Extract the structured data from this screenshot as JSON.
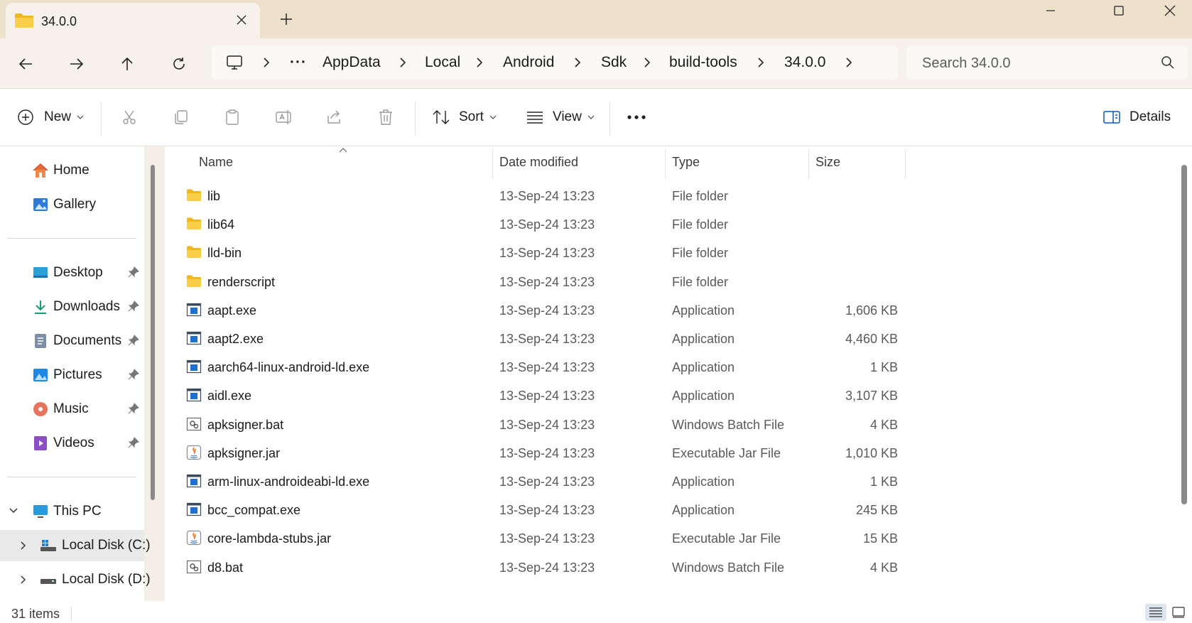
{
  "window": {
    "tab_title": "34.0.0",
    "tab_icon": "folder-icon",
    "new_tab_icon": "plus-icon",
    "controls": [
      "minimize-icon",
      "maximize-icon",
      "close-icon"
    ]
  },
  "nav_buttons": [
    "back-arrow-icon",
    "forward-arrow-icon",
    "up-arrow-icon",
    "refresh-icon"
  ],
  "breadcrumb": {
    "root_icon": "monitor-icon",
    "overflow": "···",
    "items": [
      "AppData",
      "Local",
      "Android",
      "Sdk",
      "build-tools",
      "34.0.0"
    ]
  },
  "search": {
    "placeholder": "Search 34.0.0"
  },
  "command_bar": {
    "new_label": "New",
    "sort_label": "Sort",
    "view_label": "View",
    "more_label": "···",
    "details_label": "Details",
    "disabled_actions": [
      "cut-icon",
      "copy-icon",
      "paste-icon",
      "rename-icon",
      "share-icon",
      "delete-icon"
    ]
  },
  "nav_pane": {
    "quick": [
      {
        "label": "Home",
        "icon": "home-icon"
      },
      {
        "label": "Gallery",
        "icon": "gallery-icon"
      }
    ],
    "pinned": [
      {
        "label": "Desktop",
        "icon": "desktop-icon"
      },
      {
        "label": "Downloads",
        "icon": "downloads-icon"
      },
      {
        "label": "Documents",
        "icon": "documents-icon"
      },
      {
        "label": "Pictures",
        "icon": "pictures-icon"
      },
      {
        "label": "Music",
        "icon": "music-icon"
      },
      {
        "label": "Videos",
        "icon": "videos-icon"
      }
    ],
    "this_pc": "This PC",
    "drives": [
      {
        "label": "Local Disk (C:)",
        "selected": true
      },
      {
        "label": "Local Disk (D:)",
        "selected": false
      }
    ]
  },
  "columns": {
    "name": "Name",
    "date": "Date modified",
    "type": "Type",
    "size": "Size"
  },
  "files": [
    {
      "name": "lib",
      "date": "13-Sep-24 13:23",
      "type": "File folder",
      "size": "",
      "icon": "folder"
    },
    {
      "name": "lib64",
      "date": "13-Sep-24 13:23",
      "type": "File folder",
      "size": "",
      "icon": "folder"
    },
    {
      "name": "lld-bin",
      "date": "13-Sep-24 13:23",
      "type": "File folder",
      "size": "",
      "icon": "folder"
    },
    {
      "name": "renderscript",
      "date": "13-Sep-24 13:23",
      "type": "File folder",
      "size": "",
      "icon": "folder"
    },
    {
      "name": "aapt.exe",
      "date": "13-Sep-24 13:23",
      "type": "Application",
      "size": "1,606 KB",
      "icon": "exe"
    },
    {
      "name": "aapt2.exe",
      "date": "13-Sep-24 13:23",
      "type": "Application",
      "size": "4,460 KB",
      "icon": "exe"
    },
    {
      "name": "aarch64-linux-android-ld.exe",
      "date": "13-Sep-24 13:23",
      "type": "Application",
      "size": "1 KB",
      "icon": "exe"
    },
    {
      "name": "aidl.exe",
      "date": "13-Sep-24 13:23",
      "type": "Application",
      "size": "3,107 KB",
      "icon": "exe"
    },
    {
      "name": "apksigner.bat",
      "date": "13-Sep-24 13:23",
      "type": "Windows Batch File",
      "size": "4 KB",
      "icon": "bat"
    },
    {
      "name": "apksigner.jar",
      "date": "13-Sep-24 13:23",
      "type": "Executable Jar File",
      "size": "1,010 KB",
      "icon": "jar"
    },
    {
      "name": "arm-linux-androideabi-ld.exe",
      "date": "13-Sep-24 13:23",
      "type": "Application",
      "size": "1 KB",
      "icon": "exe"
    },
    {
      "name": "bcc_compat.exe",
      "date": "13-Sep-24 13:23",
      "type": "Application",
      "size": "245 KB",
      "icon": "exe"
    },
    {
      "name": "core-lambda-stubs.jar",
      "date": "13-Sep-24 13:23",
      "type": "Executable Jar File",
      "size": "15 KB",
      "icon": "jar"
    },
    {
      "name": "d8.bat",
      "date": "13-Sep-24 13:23",
      "type": "Windows Batch File",
      "size": "4 KB",
      "icon": "bat"
    }
  ],
  "status": {
    "item_count": "31 items"
  },
  "colors": {
    "accent": "#0067c0",
    "folder": "#f7c940",
    "titlebar": "#eee1cc"
  }
}
